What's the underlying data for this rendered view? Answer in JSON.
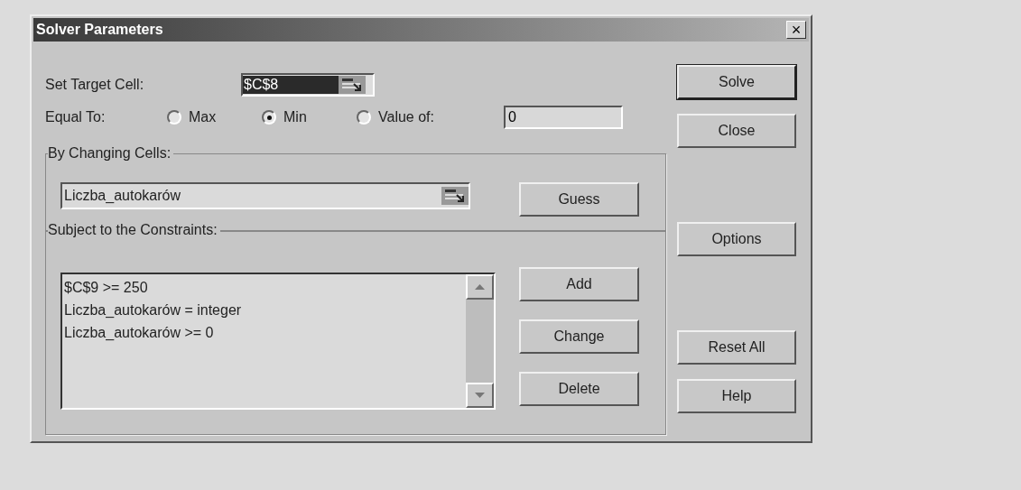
{
  "window": {
    "title": "Solver Parameters",
    "close": "×"
  },
  "target_cell": {
    "label": "Set Target Cell:",
    "value": "$C$8"
  },
  "equal_to": {
    "label": "Equal To:",
    "options": [
      {
        "label": "Max",
        "selected": false
      },
      {
        "label": "Min",
        "selected": true
      },
      {
        "label": "Value of:",
        "selected": false
      }
    ],
    "value_of": "0"
  },
  "changing_cells": {
    "label": "By Changing Cells:",
    "value": "Liczba_autokarów",
    "button": {
      "label": "Guess"
    }
  },
  "constraints": {
    "label": "Subject to the Constraints:",
    "items": [
      "$C$9 >= 250",
      "Liczba_autokarów = integer",
      "Liczba_autokarów >= 0"
    ],
    "buttons": [
      {
        "label": "Add"
      },
      {
        "label": "Change"
      },
      {
        "label": "Delete"
      }
    ]
  },
  "side_buttons": [
    {
      "label": "Solve",
      "default": true
    },
    {
      "label": "Close",
      "default": false
    },
    {
      "label": "Options",
      "default": false
    },
    {
      "label": "Reset All",
      "default": false
    },
    {
      "label": "Help",
      "default": false
    }
  ]
}
